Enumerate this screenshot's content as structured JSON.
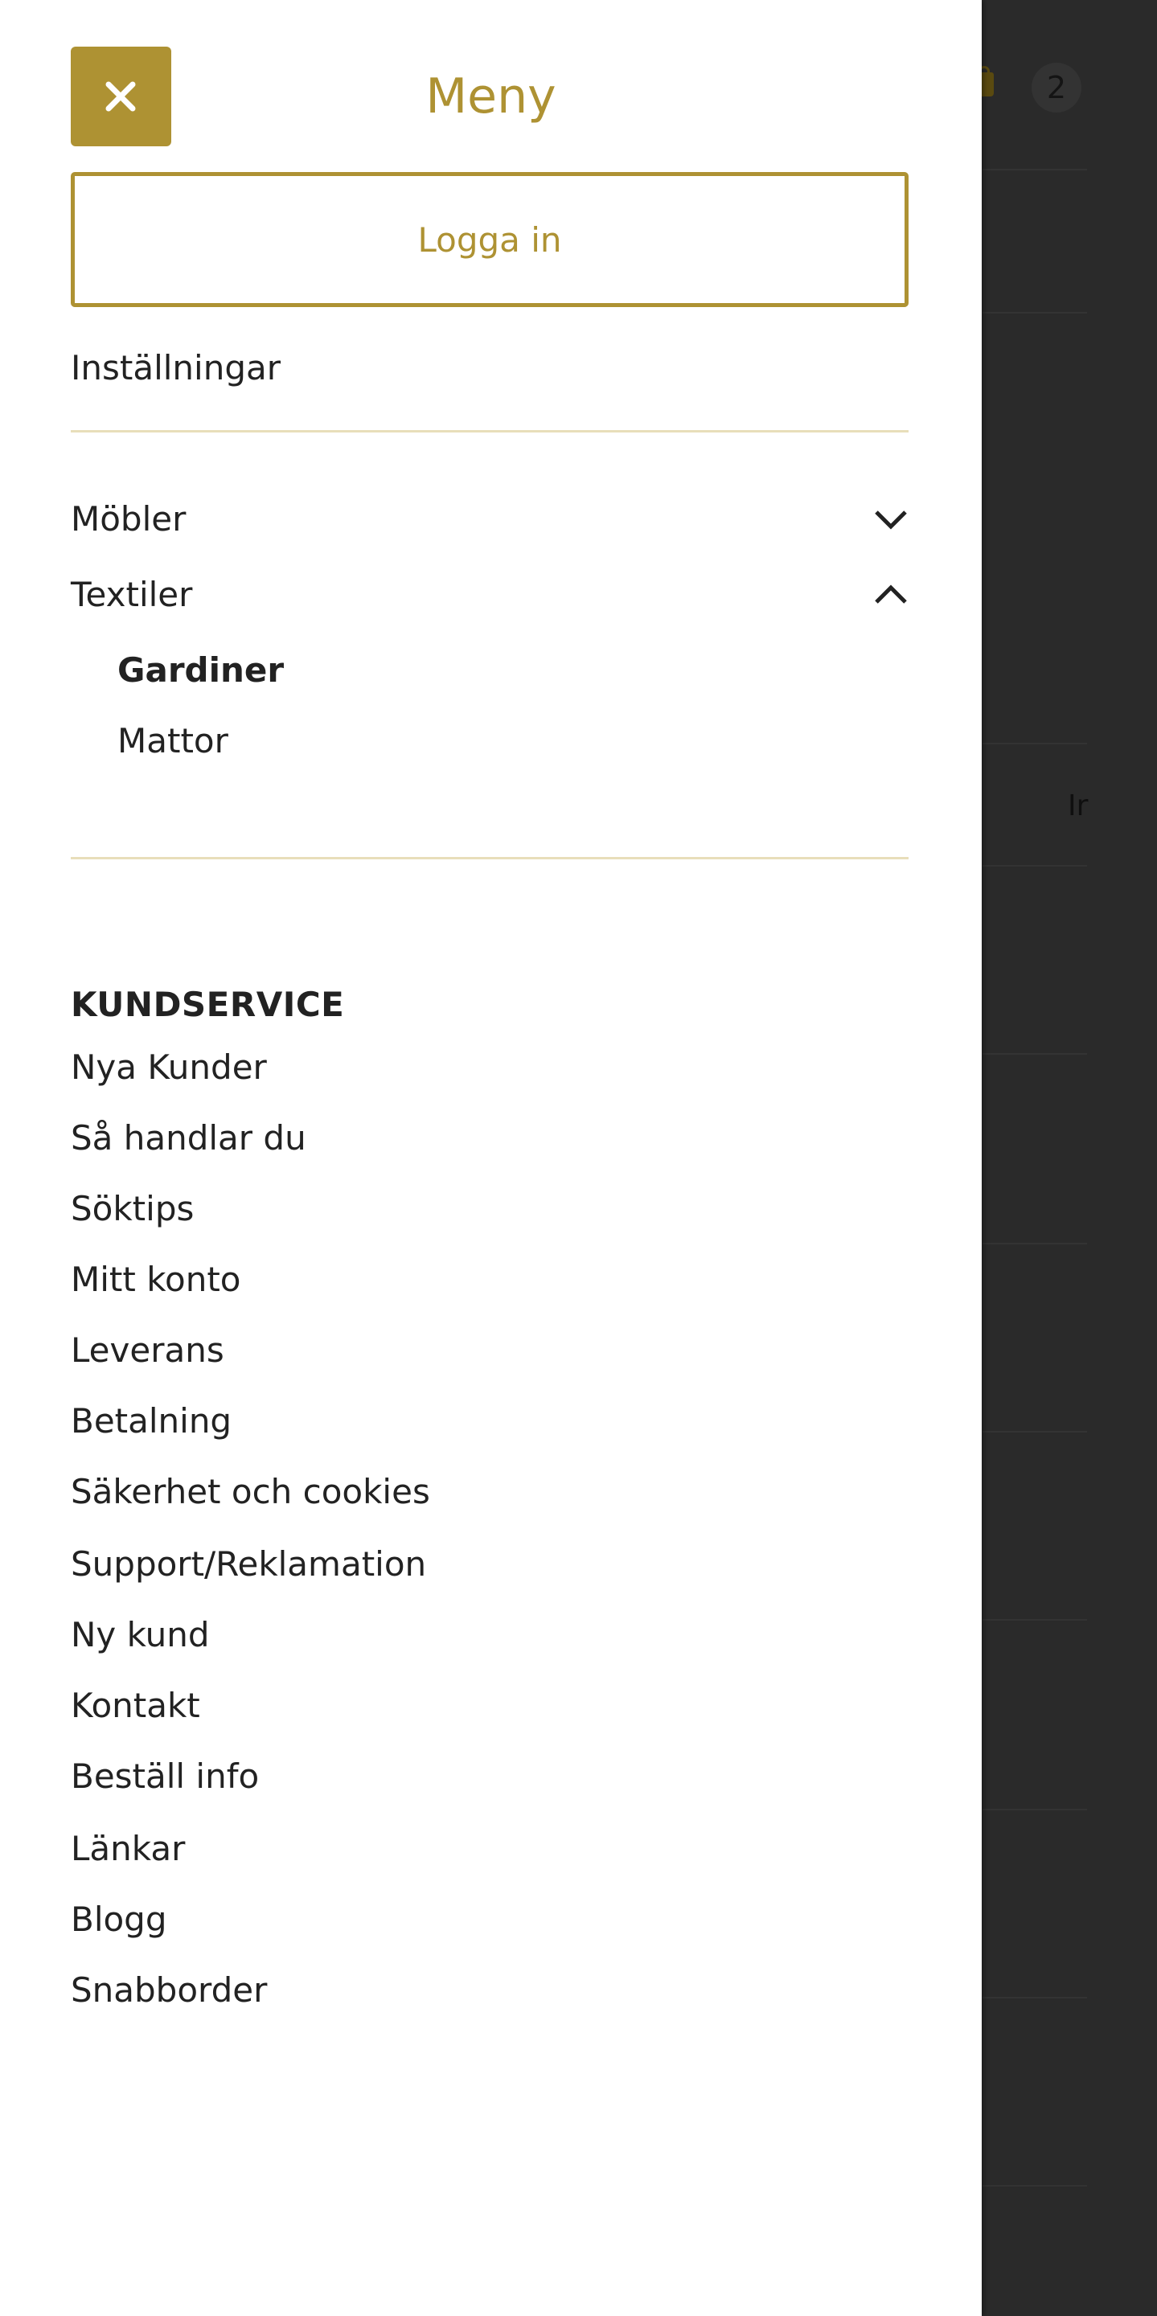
{
  "menu": {
    "title": "Meny",
    "close_icon": "close-icon",
    "login_label": "Logga in",
    "settings_label": "Inställningar",
    "accent_color": "#ae9233"
  },
  "categories": [
    {
      "label": "Möbler",
      "expanded": false,
      "icon": "chevron-down-icon"
    },
    {
      "label": "Textiler",
      "expanded": true,
      "icon": "chevron-up-icon",
      "children": [
        {
          "label": "Gardiner",
          "active": true
        },
        {
          "label": "Mattor",
          "active": false
        }
      ]
    }
  ],
  "customer_service": {
    "heading": "KUNDSERVICE",
    "links": [
      "Nya Kunder",
      "Så handlar du",
      "Söktips",
      "Mitt konto",
      "Leverans",
      "Betalning",
      "Säkerhet och cookies",
      "Support/Reklamation",
      "Ny kund",
      "Kontakt",
      "Beställ info",
      "Länkar",
      "Blogg",
      "Snabborder"
    ]
  },
  "background": {
    "cart_icon": "shopping-bag-icon",
    "cart_count": "2",
    "text_fragment": "Ir"
  }
}
